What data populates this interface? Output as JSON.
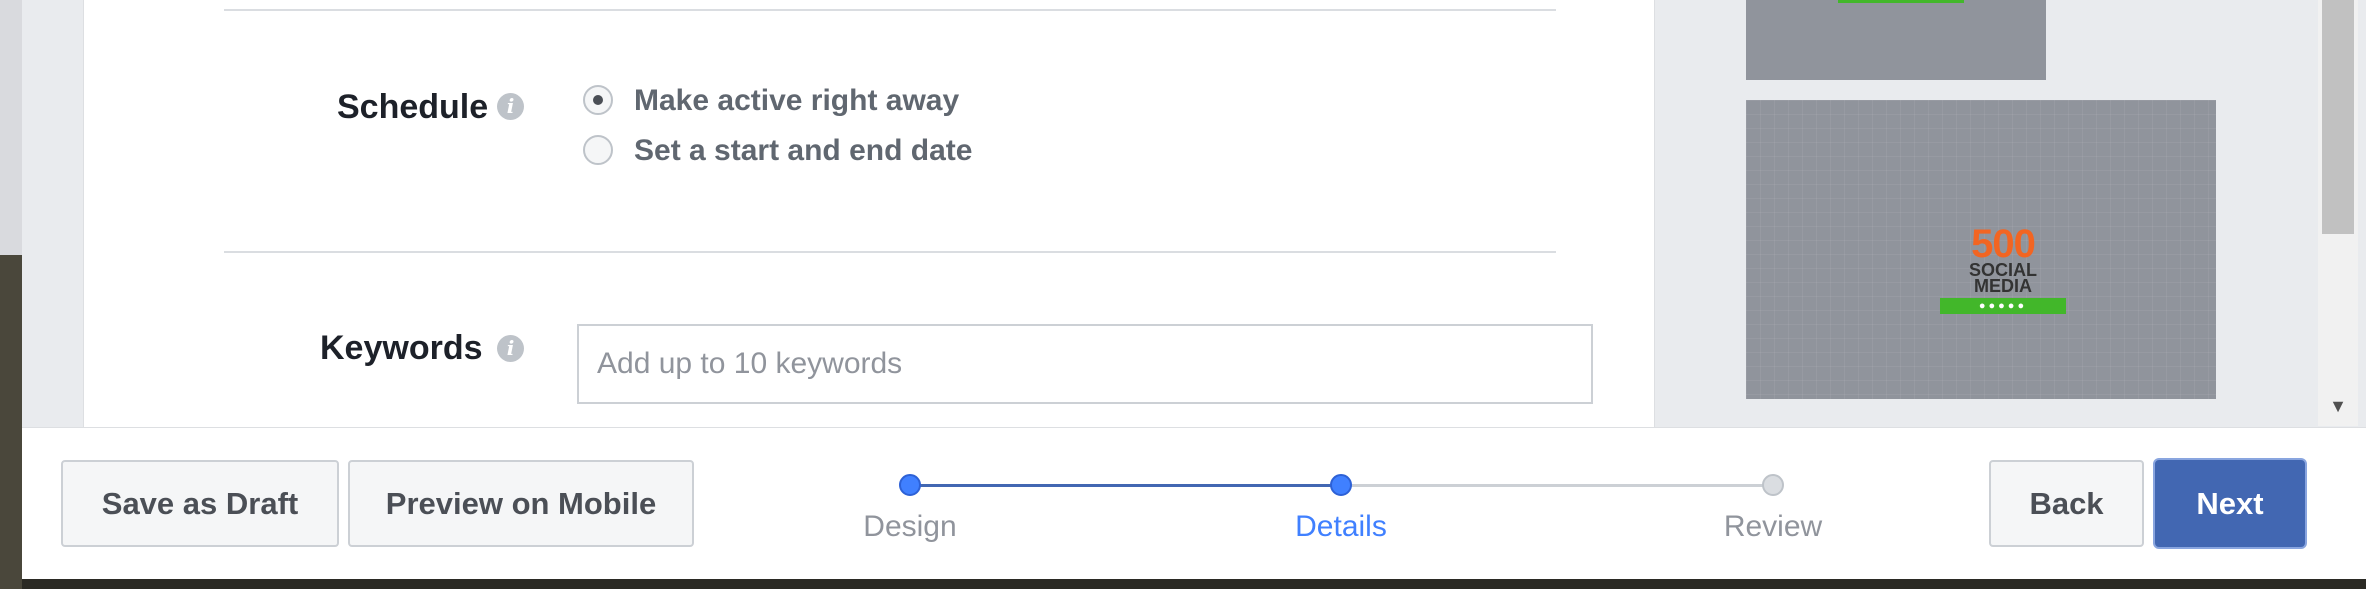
{
  "form": {
    "schedule": {
      "label": "Schedule",
      "options": [
        {
          "label": "Make active right away",
          "selected": true
        },
        {
          "label": "Set a start and end date",
          "selected": false
        }
      ]
    },
    "keywords": {
      "label": "Keywords",
      "value": "",
      "placeholder": "Add up to 10 keywords"
    }
  },
  "preview": {
    "logo_number": "500",
    "logo_line1": "SOCIAL",
    "logo_line2": "MEDIA"
  },
  "footer": {
    "save_draft_label": "Save as Draft",
    "preview_mobile_label": "Preview on Mobile",
    "back_label": "Back",
    "next_label": "Next",
    "steps": [
      {
        "label": "Design",
        "state": "done"
      },
      {
        "label": "Details",
        "state": "current"
      },
      {
        "label": "Review",
        "state": "todo"
      }
    ]
  },
  "colors": {
    "primary": "#4267b2",
    "step_active": "#4080ff",
    "logo_orange": "#f26522",
    "logo_green": "#42b72a"
  },
  "icons": {
    "info": "info-icon",
    "scroll_down": "scroll-down-arrow-icon"
  }
}
